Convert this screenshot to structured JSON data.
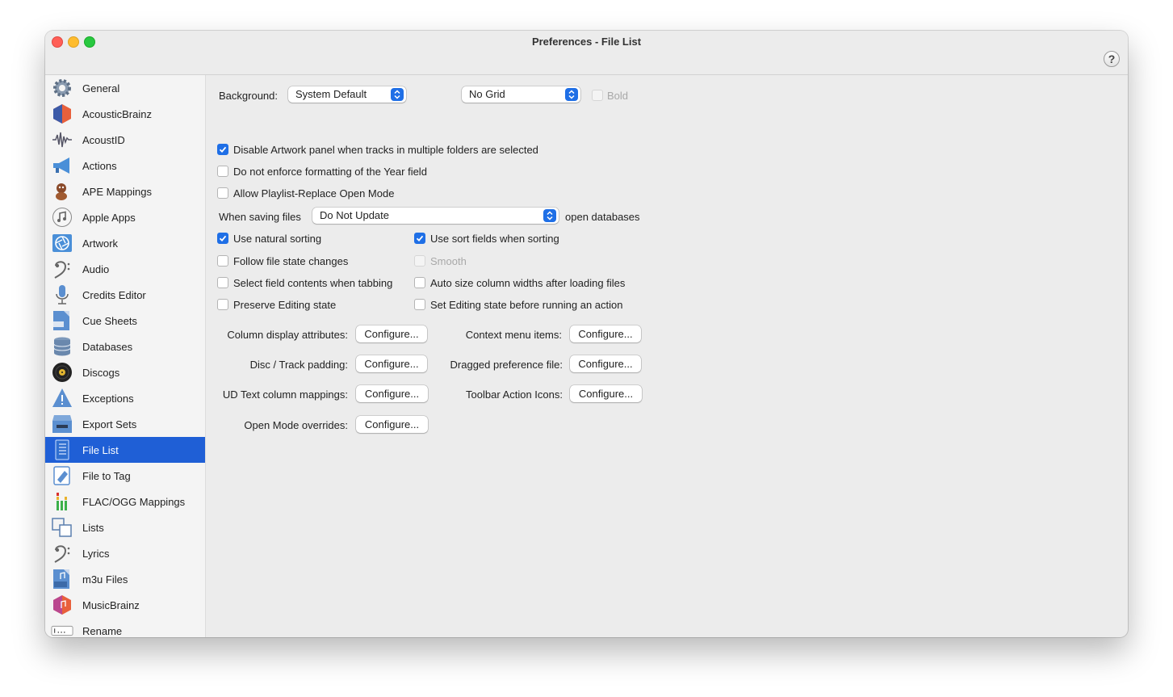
{
  "window": {
    "title": "Preferences - File List",
    "help_label": "?"
  },
  "sidebar": {
    "items": [
      {
        "label": "General",
        "icon": "gear-icon"
      },
      {
        "label": "AcousticBrainz",
        "icon": "acousticbrainz-icon"
      },
      {
        "label": "AcoustID",
        "icon": "waveform-icon"
      },
      {
        "label": "Actions",
        "icon": "megaphone-icon"
      },
      {
        "label": "APE Mappings",
        "icon": "ape-icon"
      },
      {
        "label": "Apple Apps",
        "icon": "music-note-icon"
      },
      {
        "label": "Artwork",
        "icon": "aperture-icon"
      },
      {
        "label": "Audio",
        "icon": "bass-clef-icon"
      },
      {
        "label": "Credits Editor",
        "icon": "microphone-icon"
      },
      {
        "label": "Cue Sheets",
        "icon": "cue-sheet-icon"
      },
      {
        "label": "Databases",
        "icon": "database-icon"
      },
      {
        "label": "Discogs",
        "icon": "vinyl-record-icon"
      },
      {
        "label": "Exceptions",
        "icon": "warning-icon"
      },
      {
        "label": "Export Sets",
        "icon": "export-box-icon"
      },
      {
        "label": "File List",
        "icon": "file-list-icon",
        "selected": true
      },
      {
        "label": "File to Tag",
        "icon": "tag-icon"
      },
      {
        "label": "FLAC/OGG Mappings",
        "icon": "level-meter-icon"
      },
      {
        "label": "Lists",
        "icon": "lists-icon"
      },
      {
        "label": "Lyrics",
        "icon": "bass-clef-icon"
      },
      {
        "label": "m3u Files",
        "icon": "m3u-file-icon"
      },
      {
        "label": "MusicBrainz",
        "icon": "musicbrainz-icon"
      },
      {
        "label": "Rename",
        "icon": "rename-icon"
      }
    ]
  },
  "settings": {
    "background_label": "Background:",
    "background_value": "System Default",
    "grid_value": "No Grid",
    "bold_label": "Bold",
    "bold_checked": false,
    "disable_artwork_label": "Disable Artwork panel when tracks in multiple folders are selected",
    "disable_artwork_checked": true,
    "no_year_format_label": "Do not enforce formatting of the Year field",
    "no_year_format_checked": false,
    "allow_playlist_label": "Allow Playlist-Replace Open Mode",
    "allow_playlist_checked": false,
    "saving_files_label": "When saving files",
    "saving_files_value": "Do Not Update",
    "open_databases_label": "open databases",
    "natural_sorting_label": "Use natural sorting",
    "natural_sorting_checked": true,
    "sort_fields_label": "Use sort fields when sorting",
    "sort_fields_checked": true,
    "follow_state_label": "Follow file state changes",
    "follow_state_checked": false,
    "smooth_label": "Smooth",
    "smooth_checked": false,
    "select_field_label": "Select field contents when tabbing",
    "select_field_checked": false,
    "auto_size_label": "Auto size column widths after loading files",
    "auto_size_checked": false,
    "preserve_editing_label": "Preserve Editing state",
    "preserve_editing_checked": false,
    "set_editing_label": "Set Editing state before running an action",
    "set_editing_checked": false
  },
  "configure": {
    "button_label": "Configure...",
    "column_display_label": "Column display attributes:",
    "context_menu_label": "Context menu items:",
    "disc_track_label": "Disc / Track padding:",
    "dragged_pref_label": "Dragged preference file:",
    "ud_text_label": "UD Text column mappings:",
    "toolbar_icons_label": "Toolbar Action Icons:",
    "open_mode_label": "Open Mode overrides:"
  },
  "colors": {
    "accent": "#1f6fe6",
    "selection": "#1f5fd6"
  }
}
